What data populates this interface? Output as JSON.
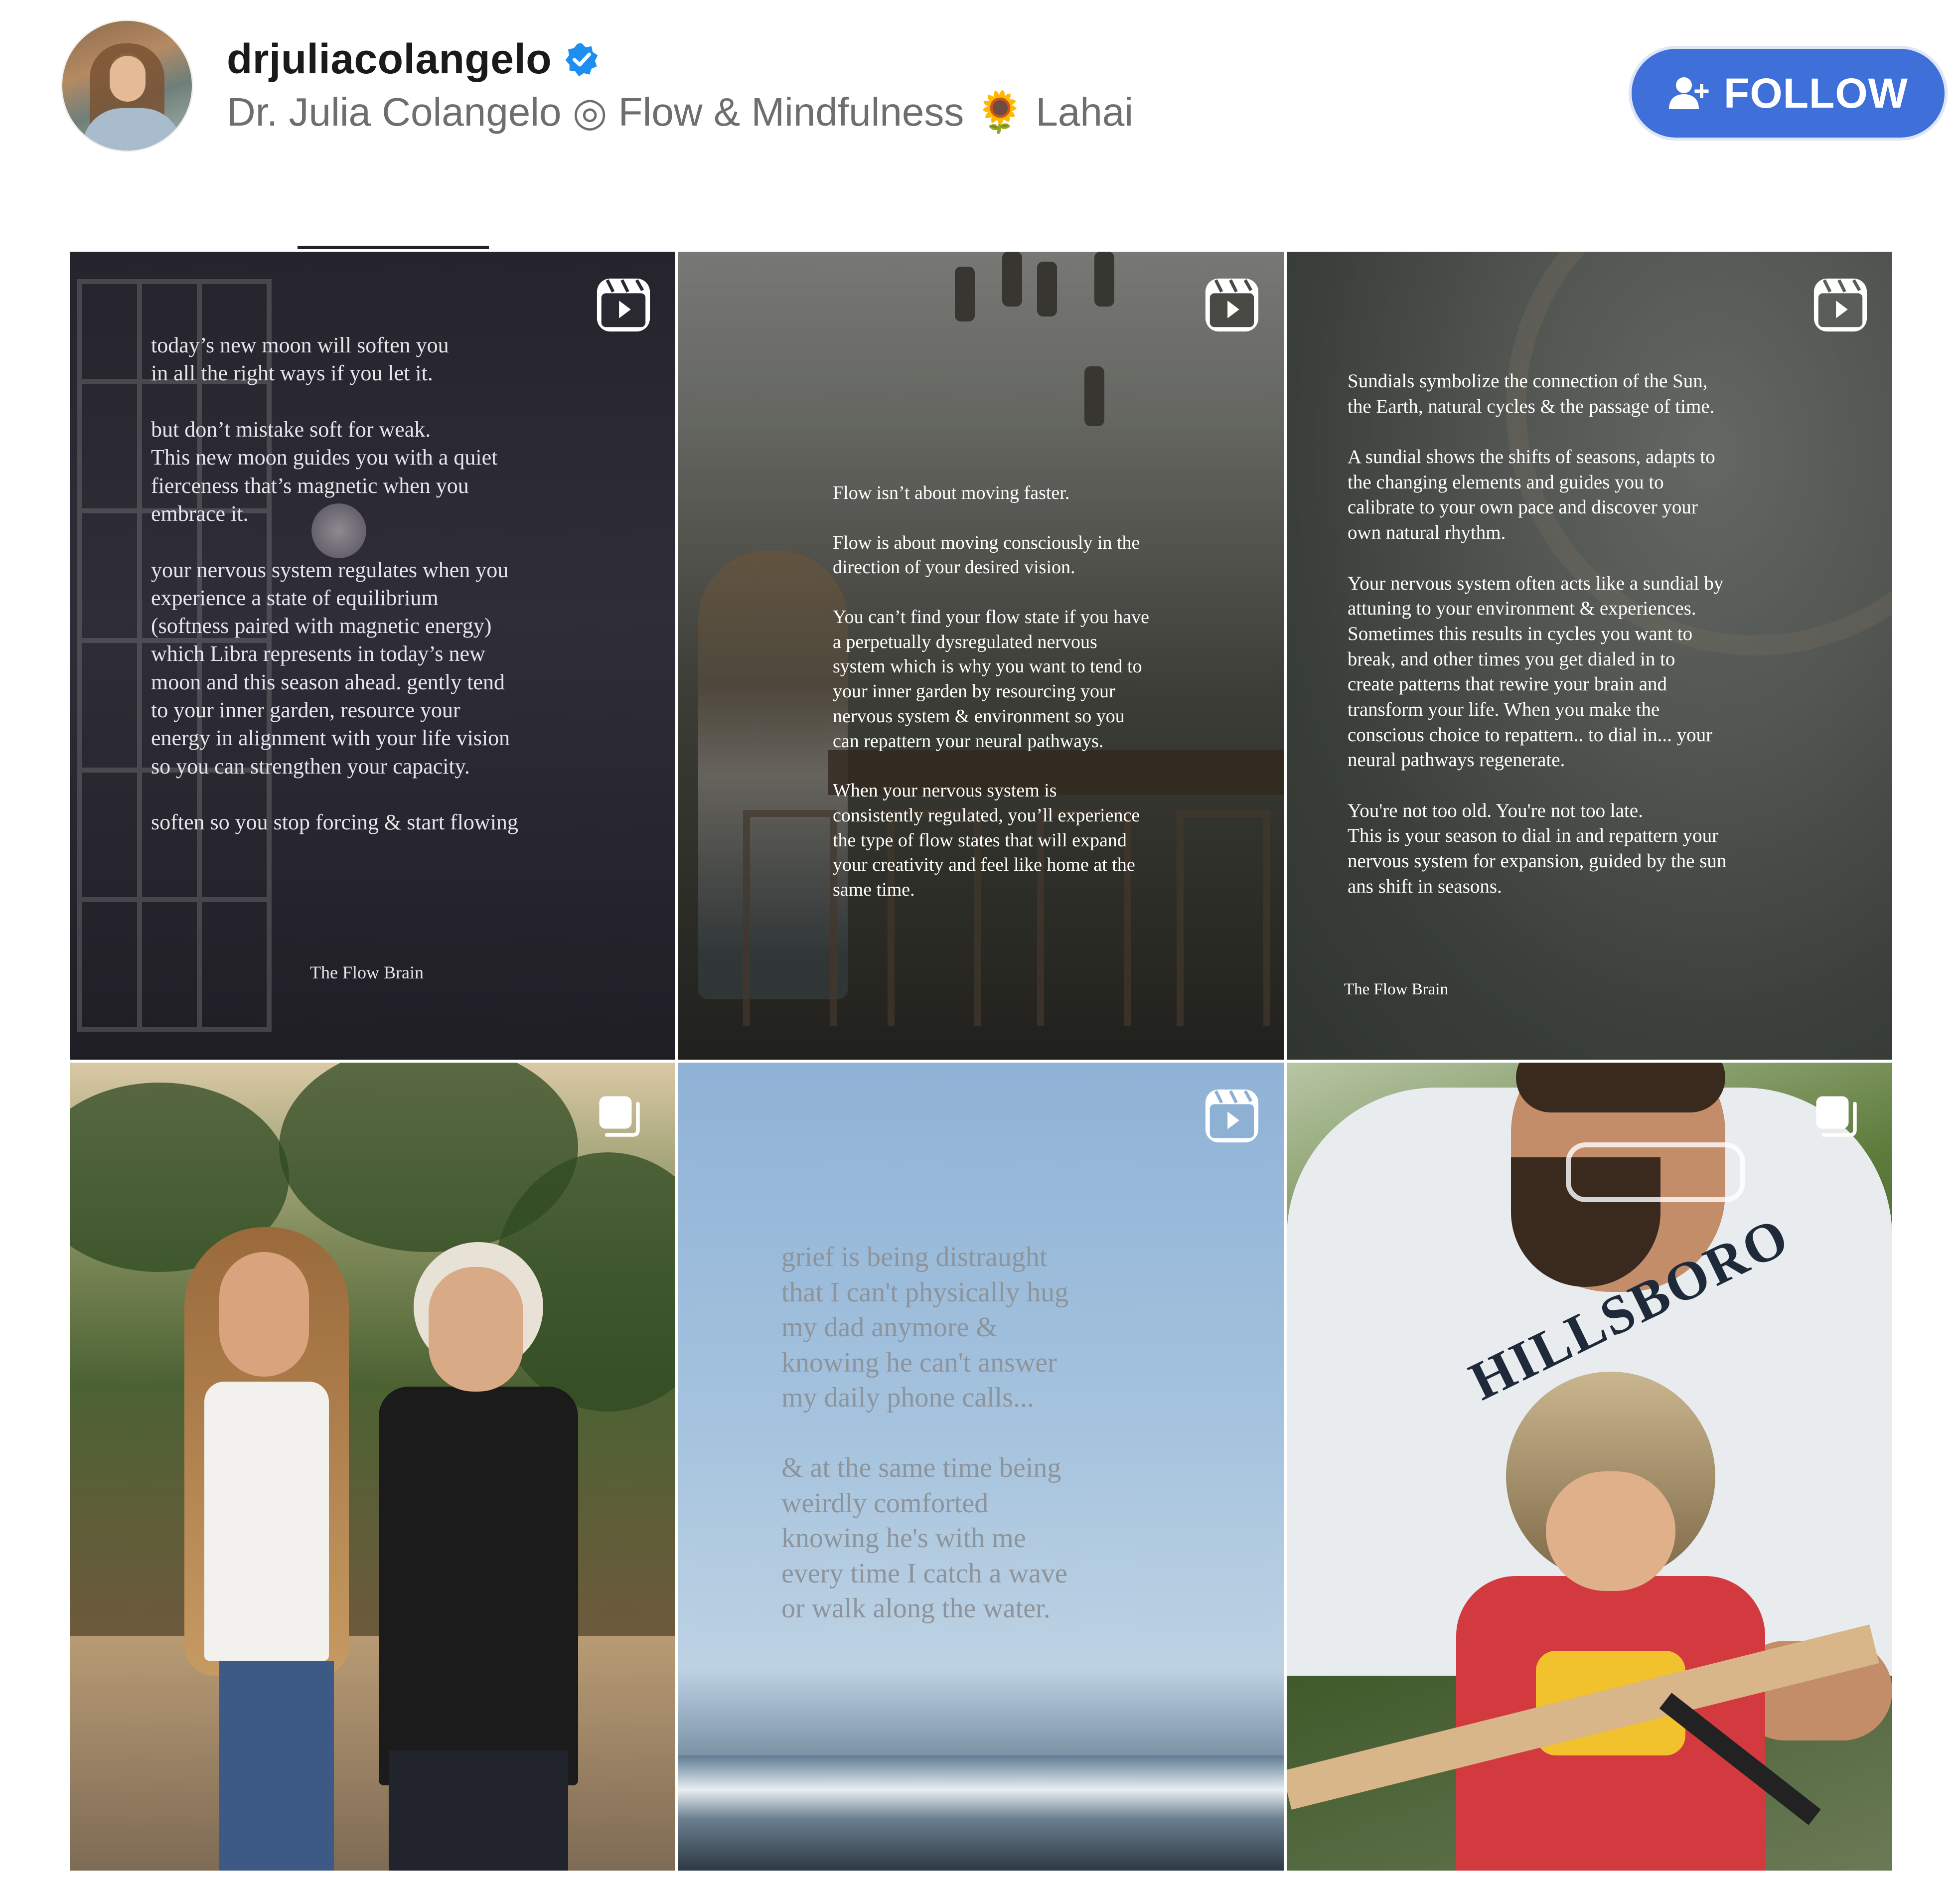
{
  "profile": {
    "username": "drjuliacolangelo",
    "verified": true,
    "full_name": "Dr. Julia Colangelo ◎ Flow & Mindfulness 🌻 Lahai",
    "follow_label": "FOLLOW"
  },
  "colors": {
    "follow_button": "#3f6fd8",
    "verified_badge": "#1f8ef1",
    "username_text": "#1a1a1a",
    "subtitle_text": "#6e6e6e"
  },
  "posts": [
    {
      "type": "reel",
      "icon": "reel-icon",
      "text": "today’s new moon will soften you\nin all the right ways if you let it.\n\nbut don’t mistake soft for weak.\nThis new moon guides you with a quiet\nfierceness that’s magnetic when you\nembrace it.\n\nyour nervous system regulates when you\nexperience a state of equilibrium\n(softness paired with magnetic energy)\nwhich Libra represents in today’s new\nmoon and this season ahead. gently tend\nto your inner garden, resource your\nenergy in alignment with your life vision\nso you can strengthen your capacity.\n\nsoften so you stop forcing & start flowing",
      "signature": "The Flow Brain"
    },
    {
      "type": "reel",
      "icon": "reel-icon",
      "text": "Flow isn’t about moving faster.\n\nFlow is about moving consciously in the\ndirection of your desired vision.\n\nYou can’t find your flow state if you have\na perpetually dysregulated nervous\nsystem which is why you want to tend to\nyour inner garden by resourcing your\nnervous system & environment so you\ncan repattern your neural pathways.\n\nWhen your nervous system is\nconsistently regulated, you’ll experience\nthe type of flow states that will expand\nyour creativity and feel like home at the\nsame time."
    },
    {
      "type": "reel",
      "icon": "reel-icon",
      "text": "Sundials symbolize the connection of the Sun,\nthe Earth, natural cycles & the passage of time.\n\nA sundial shows the shifts of seasons, adapts to\nthe changing elements and guides you to\ncalibrate to your own pace and discover your\nown natural rhythm.\n\nYour nervous system often acts like a sundial by\nattuning to your environment & experiences.\nSometimes this results in cycles  you want to\nbreak, and other times you get dialed in to\ncreate patterns that rewire your brain and\ntransform your life. When you make the\nconscious choice to repattern.. to dial in... your\nneural pathways regenerate.\n\nYou're not too old. You're not too late.\nThis is your season to dial in and repattern your\nnervous system for expansion, guided by the sun\nans shift in seasons.",
      "signature": "The Flow Brain"
    },
    {
      "type": "carousel",
      "icon": "carousel-icon"
    },
    {
      "type": "reel",
      "icon": "reel-icon",
      "text": "grief is being distraught\nthat I can't physically hug\nmy dad anymore &\nknowing he can't answer\nmy daily phone calls...\n\n& at the same time being\nweirdly comforted\nknowing he's with me\nevery time I catch a wave\nor walk along the water."
    },
    {
      "type": "carousel",
      "icon": "carousel-icon",
      "shirt_text": "HILLSBORO"
    }
  ]
}
